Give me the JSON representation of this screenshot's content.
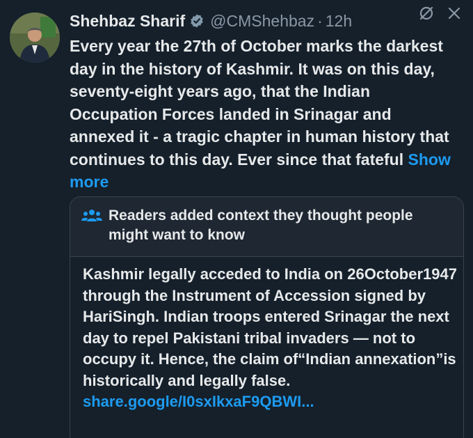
{
  "author": {
    "name": "Shehbaz Sharif",
    "handle": "@CMShehbaz",
    "separator": "·",
    "time": "12h",
    "verified_icon": "verified-badge-icon",
    "avatar": "profile-photo"
  },
  "tweet": {
    "text": "Every year the 27th of October marks the darkest day in the history of Kashmir. It was on this day, seventy-eight years ago, that the Indian Occupation Forces landed in Srinagar and annexed it - a tragic chapter in human history that continues to this day. Ever since that fateful",
    "show_more_label": "Show more"
  },
  "actions": {
    "grok_icon": "grok-icon",
    "close_icon": "close-icon"
  },
  "community_note": {
    "title": "Readers added context they thought people might want to know",
    "icon": "people-icon",
    "text": "Kashmir legally acceded to India on 26October1947 through the Instrument of Accession signed by HariSingh. Indian troops entered Srinagar the next day to repel Pakistani tribal invaders — not to occupy it. Hence, the claim of“Indian annexation”is historically and legally false.",
    "link": "share.google/I0sxIkxaF9QBWI..."
  },
  "colors": {
    "background": "#15202b",
    "text": "#e7e9ea",
    "secondary": "#8b98a5",
    "accent": "#1d9bf0",
    "border": "#38444d"
  }
}
